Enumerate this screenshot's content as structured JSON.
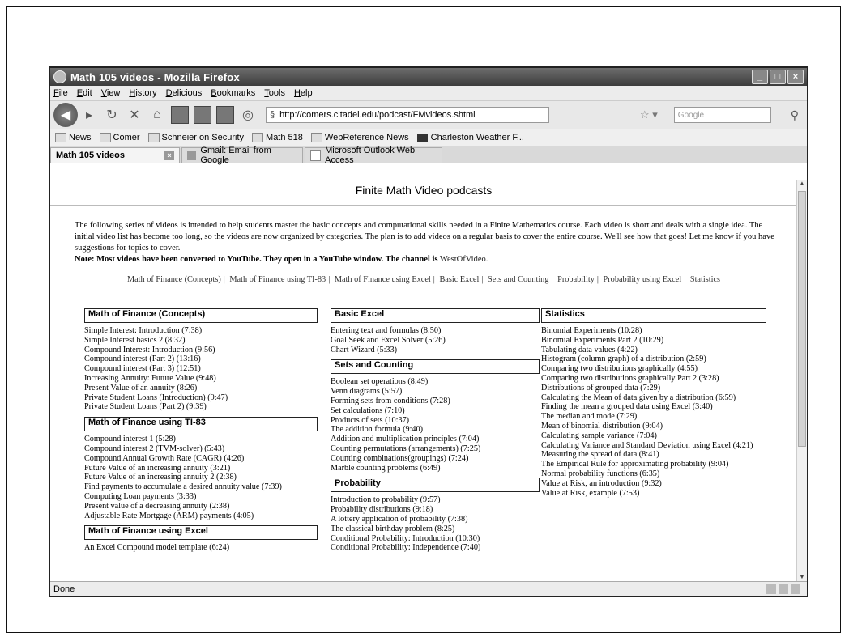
{
  "window": {
    "title": "Math 105 videos - Mozilla Firefox"
  },
  "menu": [
    "File",
    "Edit",
    "View",
    "History",
    "Delicious",
    "Bookmarks",
    "Tools",
    "Help"
  ],
  "navbar": {
    "url": "http://comers.citadel.edu/podcast/FMvideos.shtml",
    "search_placeholder": "Google"
  },
  "bookmarks": [
    "News",
    "Comer",
    "Schneier on Security",
    "Math 518",
    "WebReference News",
    "Charleston Weather F..."
  ],
  "tabs": [
    {
      "label": "Math 105 videos",
      "active": true
    },
    {
      "label": "Gmail: Email from Google",
      "active": false
    },
    {
      "label": "Microsoft Outlook Web Access",
      "active": false
    }
  ],
  "page": {
    "heading": "Finite Math Video podcasts",
    "intro": "The following series of videos is intended to help students master the basic concepts and computational skills needed in a Finite Mathematics course. Each video is short and deals with a single idea. The initial video list has become too long, so the videos are now organized by categories. The plan is to add videos on a regular basis to cover the entire course. We'll see how that goes! Let me know if you have suggestions for topics to cover.",
    "note": "Note: Most videos have been converted to YouTube. They open in a YouTube window. The channel is",
    "channel": "WestOfVideo.",
    "category_nav": [
      "Math of Finance (Concepts)",
      "Math of Finance using TI-83",
      "Math of Finance using Excel",
      "Basic Excel",
      "Sets and Counting",
      "Probability",
      "Probability using Excel",
      "Statistics"
    ]
  },
  "sections": {
    "finance_concepts": {
      "title": "Math of Finance (Concepts)",
      "items": [
        "Simple Interest: Introduction (7:38)",
        "Simple Interest basics 2 (8:32)",
        "Compound Interest: Introduction (9:56)",
        "Compound interest (Part 2) (13:16)",
        "Compound interest (Part 3) (12:51)",
        "Increasing Annuity: Future Value (9:48)",
        "Present Value of an annuity (8:26)",
        "Private Student Loans (Introduction) (9:47)",
        "Private Student Loans (Part 2) (9:39)"
      ]
    },
    "finance_ti83": {
      "title": "Math of Finance using TI-83",
      "items": [
        "Compound interest 1 (5:28)",
        "Compound interest 2 (TVM-solver) (5:43)",
        "Compound Annual Growth Rate (CAGR) (4:26)",
        "Future Value of an increasing annuity (3:21)",
        "Future Value of an increasing annuity 2 (2:38)",
        "Find payments to accumulate a desired annuity value (7:39)",
        "Computing Loan payments (3:33)",
        "Present value of a decreasing annuity (2:38)",
        "Adjustable Rate Mortgage (ARM) payments (4:05)"
      ]
    },
    "finance_excel": {
      "title": "Math of Finance using Excel",
      "items": [
        "An Excel Compound model template (6:24)"
      ]
    },
    "basic_excel": {
      "title": "Basic Excel",
      "items": [
        "Entering text and formulas (8:50)",
        "Goal Seek and Excel Solver (5:26)",
        "Chart Wizard (5:33)"
      ]
    },
    "sets_counting": {
      "title": "Sets and Counting",
      "items": [
        "Boolean set operations (8:49)",
        "Venn diagrams (5:57)",
        "Forming sets from conditions (7:28)",
        "Set calculations (7:10)",
        "Products of sets (10:37)",
        "The addition formula (9:40)",
        "Addition and multiplication principles (7:04)",
        "Counting permutations (arrangements) (7:25)",
        "Counting combinations(groupings) (7:24)",
        "Marble counting problems (6:49)"
      ]
    },
    "probability": {
      "title": "Probability",
      "items": [
        "Introduction to probability (9:57)",
        "Probability distributions (9:18)",
        "A lottery application of probability (7:38)",
        "The classical birthday problem (8:25)",
        "Conditional Probability: Introduction (10:30)",
        "Conditional Probability: Independence (7:40)"
      ]
    },
    "statistics": {
      "title": "Statistics",
      "items": [
        "Binomial Experiments (10:28)",
        "Binomial Experiments Part 2 (10:29)",
        "Tabulating data values (4:22)",
        "Histogram (column graph) of a distribution (2:59)",
        "Comparing two distributions graphically (4:55)",
        "Comparing two distributions graphically Part 2 (3:28)",
        "Distributions of grouped data (7:29)",
        "Calculating the Mean of data given by a distribution (6:59)",
        "Finding the mean a grouped data using Excel (3:40)",
        "The median and mode (7:29)",
        "Mean of binomial distribution (9:04)",
        "Calculating sample variance (7:04)",
        "Calculating Variance and Standard Deviation using Excel (4:21)",
        "Measuring the spread of data (8:41)",
        "The Empirical Rule for approximating probability (9:04)",
        "Normal probability functions (6:35)",
        "Value at Risk, an introduction (9:32)",
        "Value at Risk, example (7:53)"
      ]
    }
  },
  "status": {
    "text": "Done"
  }
}
